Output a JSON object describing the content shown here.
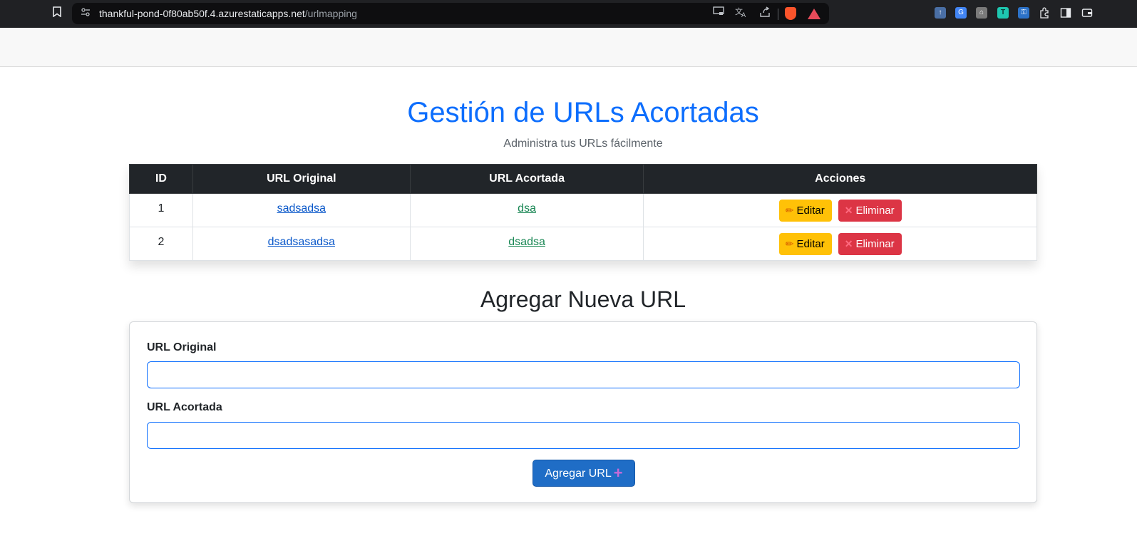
{
  "browser": {
    "url_host": "thankful-pond-0f80ab50f.4.azurestaticapps.net",
    "url_path": "/urlmapping",
    "icons": [
      "bookmark-icon",
      "site-settings-icon",
      "cast-icon",
      "translate-icon",
      "share-icon",
      "brave-shields-icon",
      "brave-rewards-icon",
      "extensions-icon",
      "sidebar-icon",
      "wallet-icon"
    ]
  },
  "header": {
    "title": "Gestión de URLs Acortadas",
    "subtitle": "Administra tus URLs fácilmente"
  },
  "table": {
    "columns": [
      "ID",
      "URL Original",
      "URL Acortada",
      "Acciones"
    ],
    "rows": [
      {
        "id": "1",
        "original": "sadsadsa",
        "short": "dsa",
        "edit_label": "Editar",
        "delete_label": "Eliminar"
      },
      {
        "id": "2",
        "original": "dsadsasadsa",
        "short": "dsadsa",
        "edit_label": "Editar",
        "delete_label": "Eliminar"
      }
    ]
  },
  "form": {
    "title": "Agregar Nueva URL",
    "original_label": "URL Original",
    "original_value": "",
    "short_label": "URL Acortada",
    "short_value": "",
    "submit_label": "Agregar URL"
  },
  "colors": {
    "primary": "#0d6efd",
    "edit": "#ffc107",
    "delete": "#dc3545",
    "submit": "#1f6dc6"
  }
}
